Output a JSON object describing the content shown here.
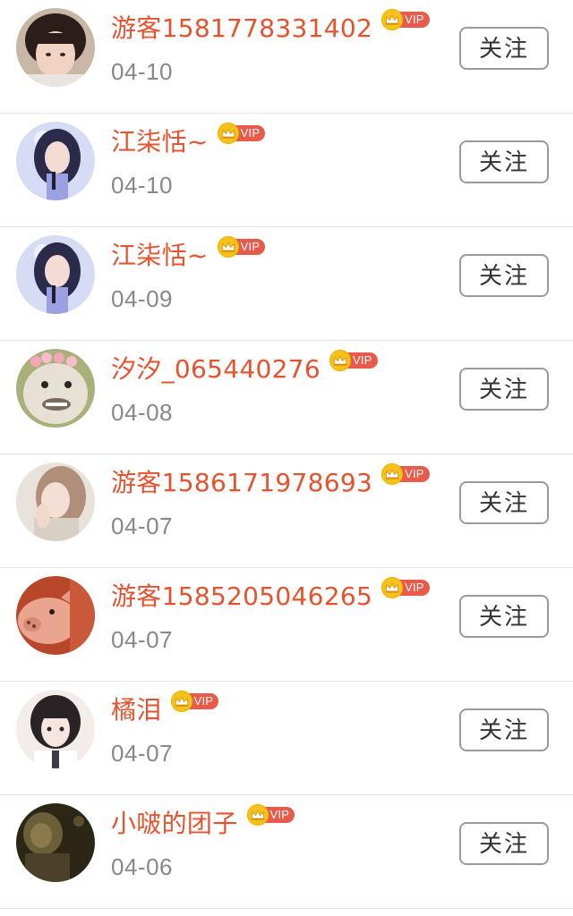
{
  "follow_list": {
    "items": [
      {
        "name": "游客1581778331402",
        "badge": "VIP",
        "date": "04-10",
        "button": "关注",
        "avatar_colors": [
          "#2b1d1a",
          "#f0d3c2"
        ]
      },
      {
        "name": "江柒恬~",
        "badge": "VIP",
        "date": "04-10",
        "button": "关注",
        "avatar_colors": [
          "#8a8fd2",
          "#2b2a4a"
        ]
      },
      {
        "name": "江柒恬~",
        "badge": "VIP",
        "date": "04-09",
        "button": "关注",
        "avatar_colors": [
          "#8a8fd2",
          "#2b2a4a"
        ]
      },
      {
        "name": "汐汐_065440276",
        "badge": "VIP",
        "date": "04-08",
        "button": "关注",
        "avatar_colors": [
          "#e7e0d4",
          "#7a6a58"
        ]
      },
      {
        "name": "游客1586171978693",
        "badge": "VIP",
        "date": "04-07",
        "button": "关注",
        "avatar_colors": [
          "#d8cfc5",
          "#b08e7a"
        ]
      },
      {
        "name": "游客1585205046265",
        "badge": "VIP",
        "date": "04-07",
        "button": "关注",
        "avatar_colors": [
          "#b8462a",
          "#e9a58e"
        ]
      },
      {
        "name": "橘泪",
        "badge": "VIP",
        "date": "04-07",
        "button": "关注",
        "avatar_colors": [
          "#f3ece8",
          "#2a2326"
        ]
      },
      {
        "name": "小啵的团子",
        "badge": "VIP",
        "date": "04-06",
        "button": "关注",
        "avatar_colors": [
          "#6b5f3a",
          "#2b2616"
        ]
      }
    ]
  },
  "colors": {
    "name": "#e5532e",
    "date": "#888888",
    "vip_crown": "#f4c21a",
    "vip_tag": "#e85a4a",
    "button_border": "#9a9a9a",
    "divider": "#e6e6e6"
  },
  "icons": {
    "vip": "crown-icon"
  }
}
